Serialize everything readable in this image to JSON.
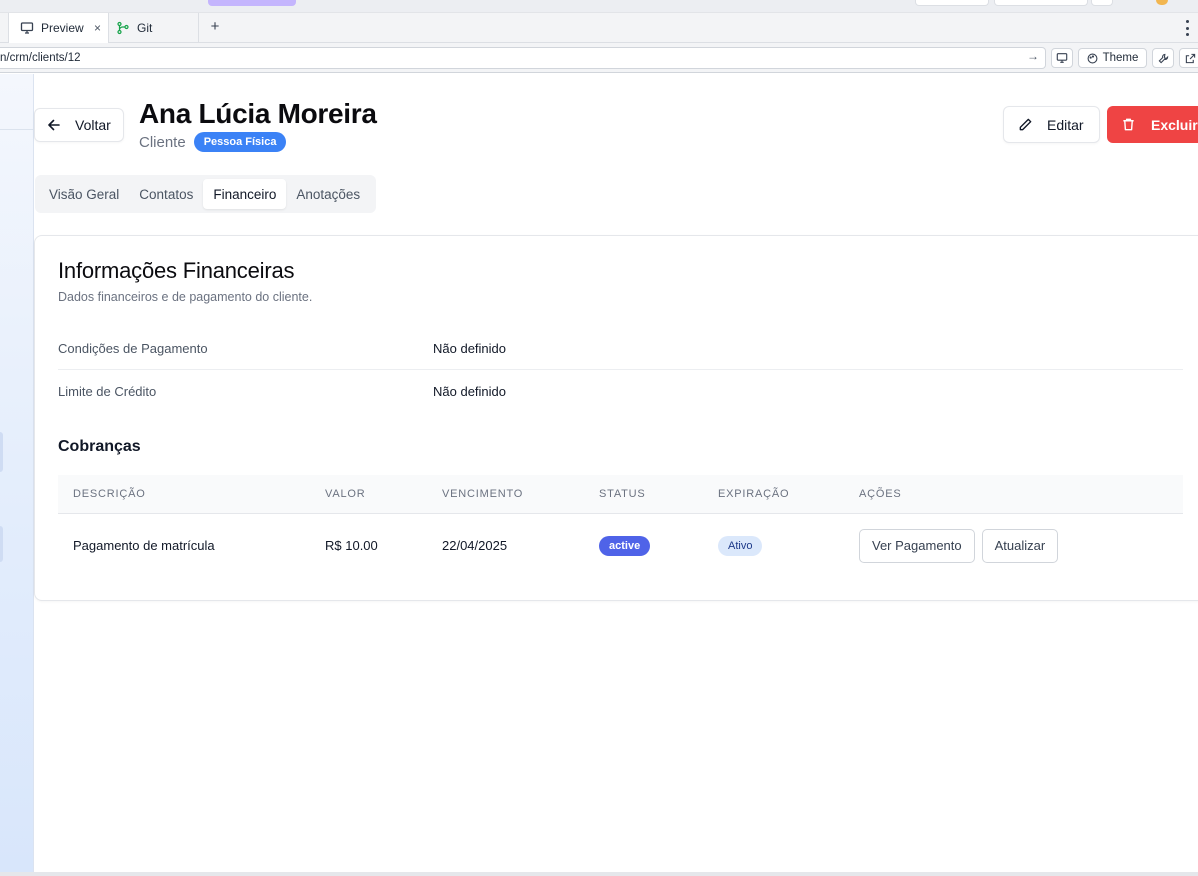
{
  "browser": {
    "tabs": [
      {
        "label": "Preview",
        "icon": "monitor-icon"
      },
      {
        "label": "Git",
        "icon": "git-branch-icon"
      }
    ],
    "new_tab": "+",
    "close": "×",
    "url": "n/crm/clients/12",
    "theme_label": "Theme"
  },
  "header": {
    "back_label": "Voltar",
    "client_name": "Ana Lúcia Moreira",
    "kind": "Cliente",
    "type_badge": "Pessoa Física",
    "edit_label": "Editar",
    "delete_label": "Excluir"
  },
  "tabs": [
    "Visão Geral",
    "Contatos",
    "Financeiro",
    "Anotações"
  ],
  "active_tab": "Financeiro",
  "financial": {
    "title": "Informações Financeiras",
    "description": "Dados financeiros e de pagamento do cliente.",
    "fields": [
      {
        "label": "Condições de Pagamento",
        "value": "Não definido"
      },
      {
        "label": "Limite de Crédito",
        "value": "Não definido"
      }
    ]
  },
  "charges": {
    "title": "Cobranças",
    "columns": [
      "DESCRIÇÃO",
      "VALOR",
      "VENCIMENTO",
      "STATUS",
      "EXPIRAÇÃO",
      "AÇÕES"
    ],
    "rows": [
      {
        "description": "Pagamento de matrícula",
        "value": "R$ 10.00",
        "due": "22/04/2025",
        "status": "active",
        "expiration": "Ativo",
        "actions": [
          "Ver Pagamento",
          "Atualizar"
        ]
      }
    ]
  },
  "colors": {
    "accent": "#3b82f6",
    "danger": "#ef4444",
    "status_active": "#4f63e8"
  }
}
